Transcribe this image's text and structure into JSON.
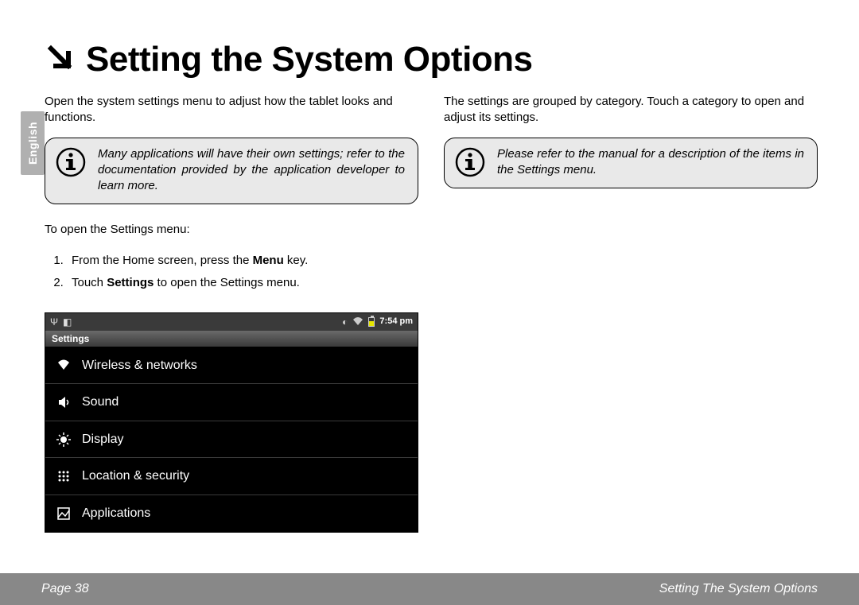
{
  "lang_tab": "English",
  "title": "Setting the System Options",
  "left": {
    "intro": "Open the system settings menu to adjust how the tablet looks and functions.",
    "callout": "Many applications will have their own settings; refer to the documentation provided by the application developer to learn more.",
    "lead": "To open the Settings menu:",
    "steps": {
      "s1_pre": "From the Home screen, press the ",
      "s1_bold": "Menu",
      "s1_post": " key.",
      "s2_pre": "Touch ",
      "s2_bold": "Settings",
      "s2_post": " to open the Settings menu."
    }
  },
  "right": {
    "intro": "The settings are grouped by category. Touch a category to open and adjust its settings.",
    "callout": "Please refer to the manual for a description of the items in the Settings menu."
  },
  "screenshot": {
    "clock": "7:54 pm",
    "titlebar": "Settings",
    "items": [
      "Wireless & networks",
      "Sound",
      "Display",
      "Location & security",
      "Applications"
    ],
    "icons": [
      "wifi-icon",
      "sound-icon",
      "display-icon",
      "location-icon",
      "applications-icon"
    ]
  },
  "footer": {
    "page_label": "Page 38",
    "section_label": "Setting The System Options"
  }
}
